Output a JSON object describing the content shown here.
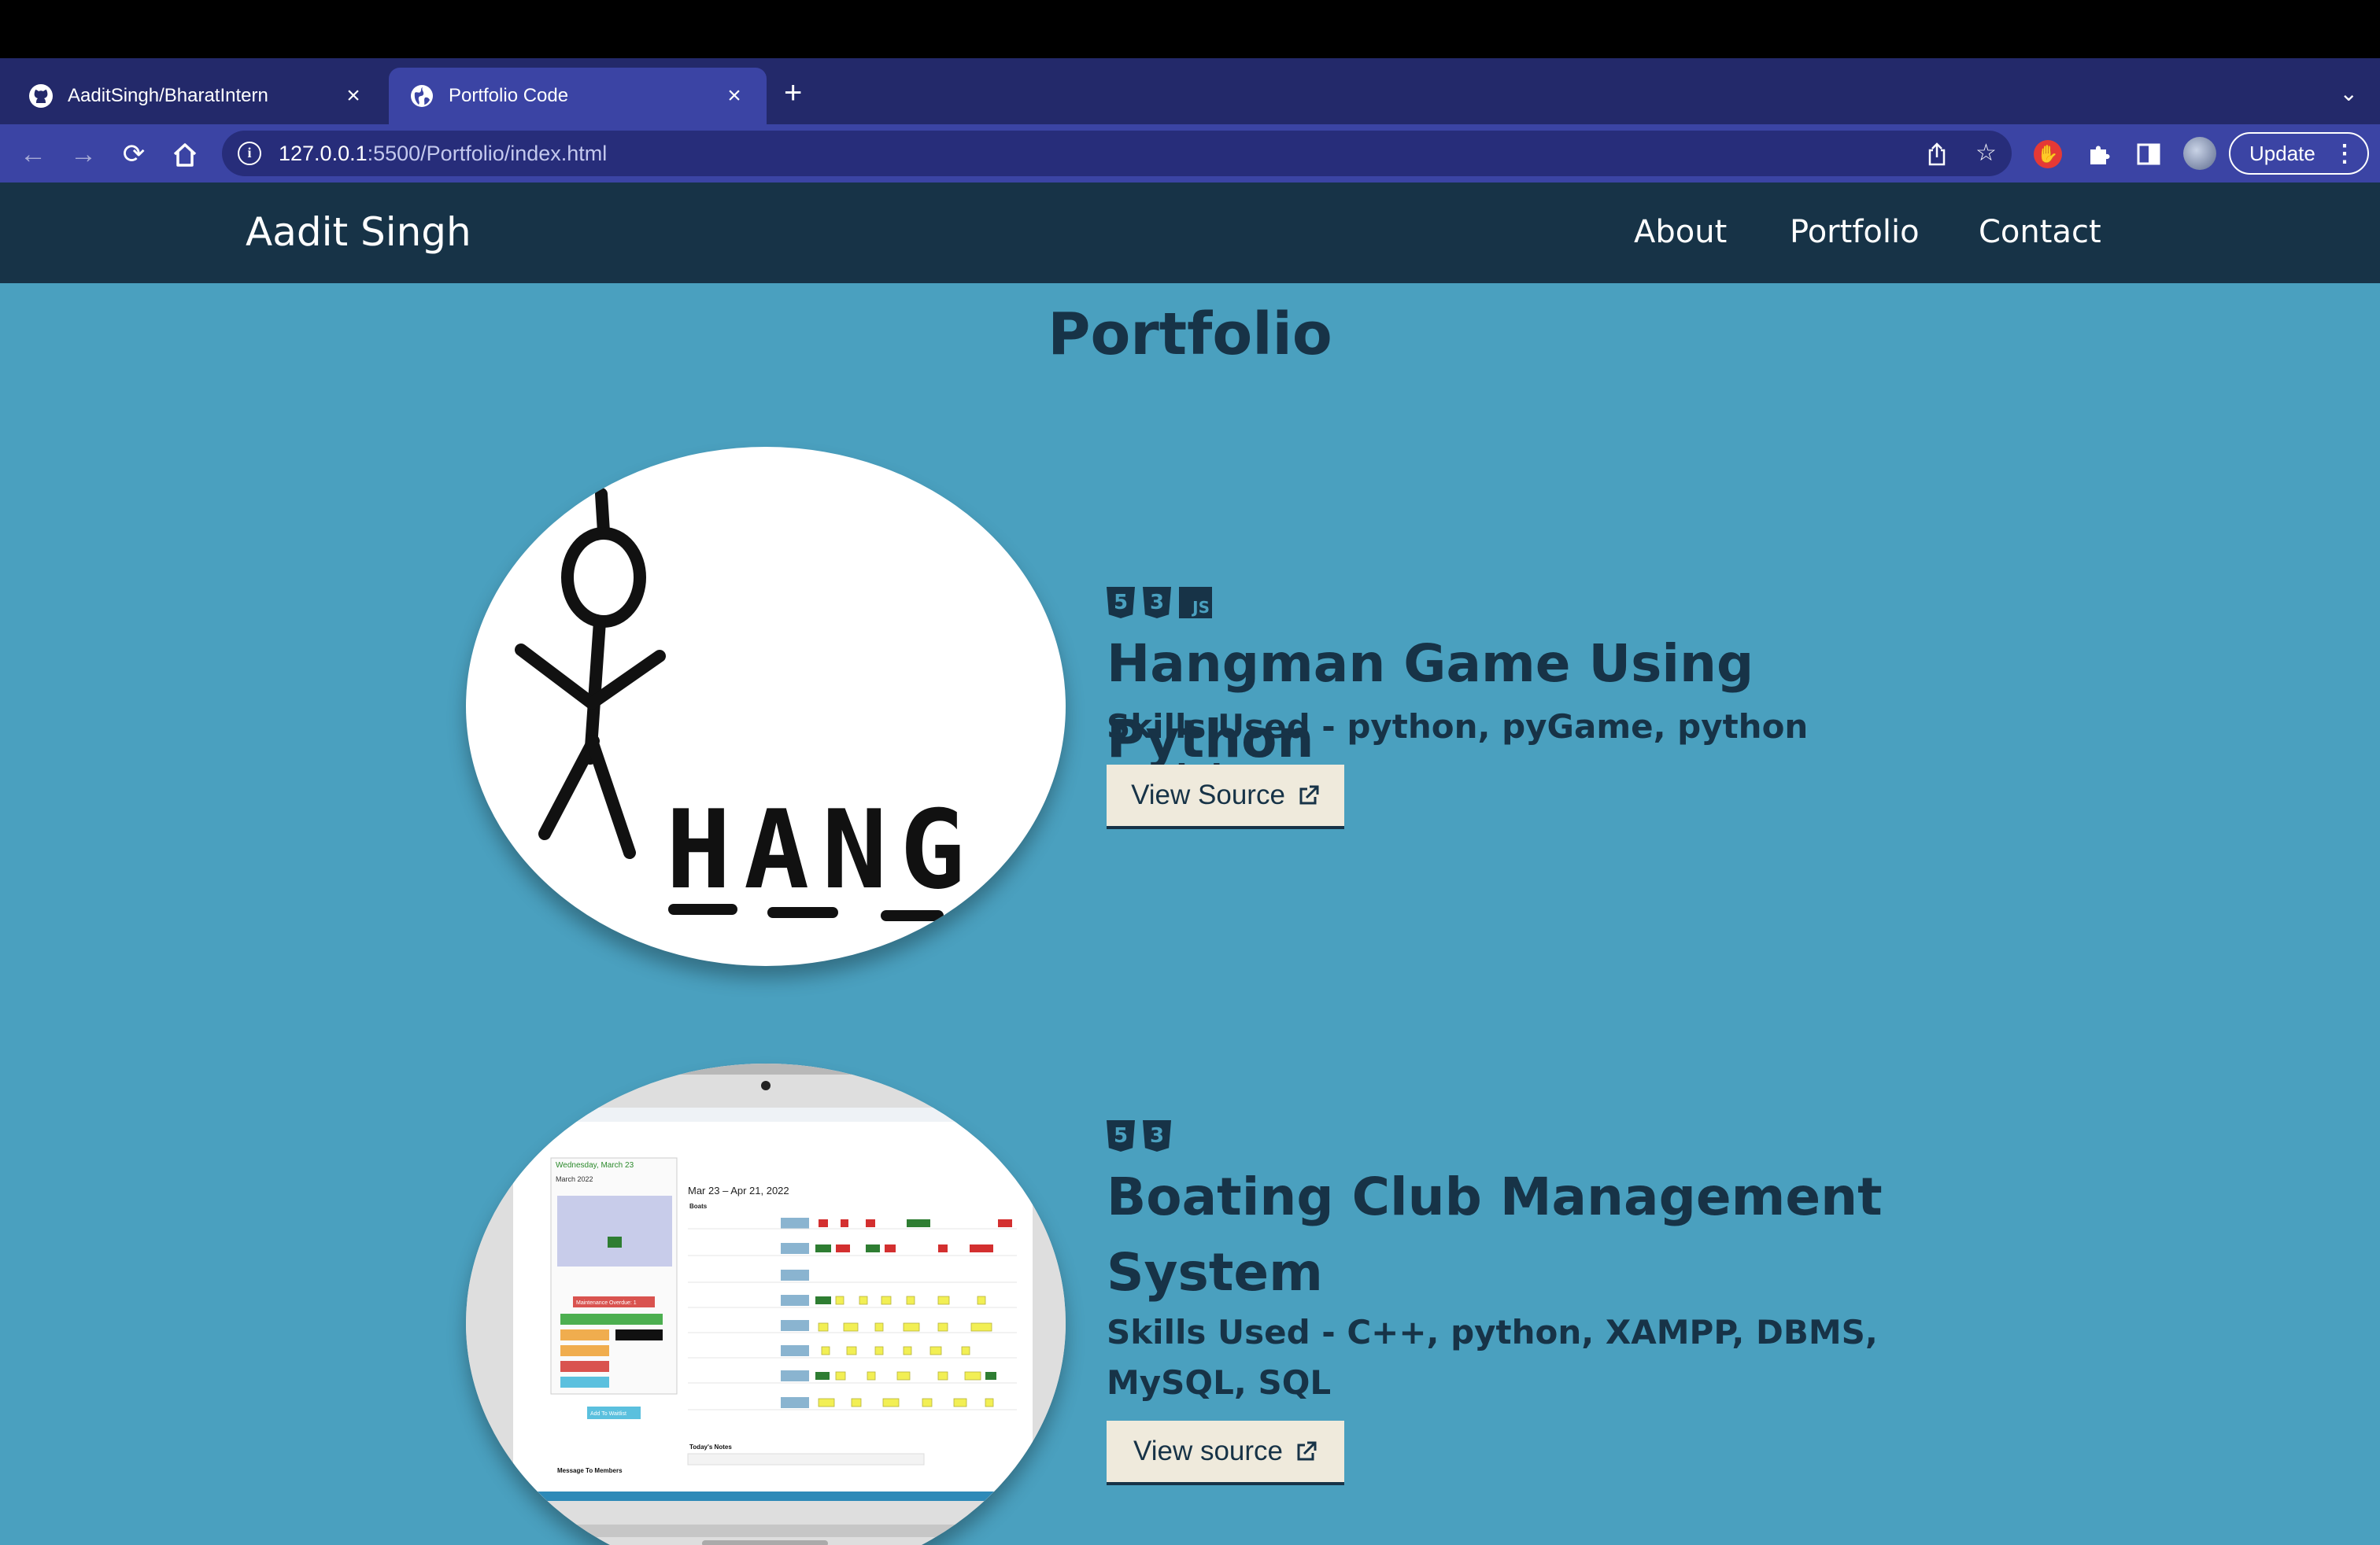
{
  "browser": {
    "tabs": [
      {
        "title": "AaditSingh/BharatIntern",
        "favicon": "github-icon",
        "active": false
      },
      {
        "title": "Portfolio Code",
        "favicon": "globe-icon",
        "active": true
      }
    ],
    "new_tab_label": "+",
    "url_host": "127.0.0.1",
    "url_path": ":5500/Portfolio/index.html",
    "update_label": "Update"
  },
  "site": {
    "brand": "Aadit Singh",
    "nav": [
      "About",
      "Portfolio",
      "Contact"
    ],
    "section_title": "Portfolio",
    "projects": [
      {
        "icons": [
          "html5-icon",
          "css3-icon",
          "js-icon"
        ],
        "title": "Hangman Game Using Python",
        "skills": "Skills Used - python, pyGame, python modules",
        "button": "View Source",
        "image_text": "HANG"
      },
      {
        "icons": [
          "html5-icon",
          "css3-icon"
        ],
        "title": "Boating Club Management System",
        "skills": "Skills Used - C++, python, XAMPP, DBMS, MySQL, SQL",
        "button": "View source",
        "image_texts": {
          "date_heading": "Wednesday, March 23",
          "month": "March 2022",
          "range": "Mar 23 – Apr 21, 2022",
          "boats_label": "Boats",
          "maintenance": "Maintenance Overdue: 1",
          "add_waitlist": "Add To Waitlist",
          "notes": "Today's Notes",
          "message": "Message To Members"
        }
      }
    ]
  },
  "colors": {
    "tab_strip": "#23296a",
    "toolbar": "#3b44a4",
    "site_nav": "#173347",
    "page_bg": "#4aa0bf",
    "button_bg": "#efeadc"
  }
}
